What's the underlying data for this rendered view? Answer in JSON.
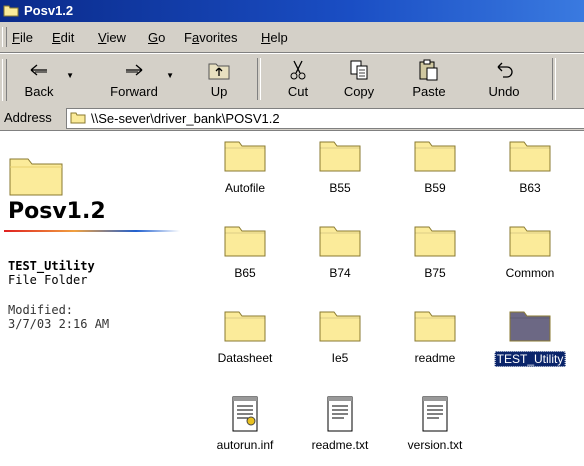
{
  "window": {
    "title": "Posv1.2"
  },
  "menu": [
    {
      "label": "File",
      "u": "F",
      "rest": "ile"
    },
    {
      "label": "Edit",
      "u": "E",
      "rest": "dit"
    },
    {
      "label": "View",
      "u": "V",
      "rest": "iew"
    },
    {
      "label": "Go",
      "u": "G",
      "rest": "o"
    },
    {
      "label": "Favorites",
      "u": "a",
      "pre": "F",
      "rest": "vorites"
    },
    {
      "label": "Help",
      "u": "H",
      "rest": "elp"
    }
  ],
  "toolbar": {
    "back": "Back",
    "forward": "Forward",
    "up": "Up",
    "cut": "Cut",
    "copy": "Copy",
    "paste": "Paste",
    "undo": "Undo"
  },
  "address": {
    "label": "Address",
    "path": "\\\\Se-sever\\driver_bank\\POSV1.2"
  },
  "left_pane": {
    "title": "Posv1.2",
    "selected_name": "TEST_Utility",
    "selected_type": "File Folder",
    "modified_label": "Modified:",
    "modified_value": "3/7/03 2:16 AM"
  },
  "items": [
    {
      "name": "Autofile",
      "kind": "folder"
    },
    {
      "name": "B55",
      "kind": "folder"
    },
    {
      "name": "B59",
      "kind": "folder"
    },
    {
      "name": "B63",
      "kind": "folder"
    },
    {
      "name": "B65",
      "kind": "folder"
    },
    {
      "name": "B74",
      "kind": "folder"
    },
    {
      "name": "B75",
      "kind": "folder"
    },
    {
      "name": "Common",
      "kind": "folder"
    },
    {
      "name": "Datasheet",
      "kind": "folder"
    },
    {
      "name": "Ie5",
      "kind": "folder"
    },
    {
      "name": "readme",
      "kind": "folder"
    },
    {
      "name": "TEST_Utility",
      "kind": "folder",
      "selected": true
    },
    {
      "name": "autorun.inf",
      "kind": "inf"
    },
    {
      "name": "readme.txt",
      "kind": "txt"
    },
    {
      "name": "version.txt",
      "kind": "txt"
    }
  ],
  "colors": {
    "folder": "#fbeb9a",
    "folder_outline": "#8a7a30",
    "selected_folder": "#6c6884",
    "selection": "#0a246a"
  }
}
